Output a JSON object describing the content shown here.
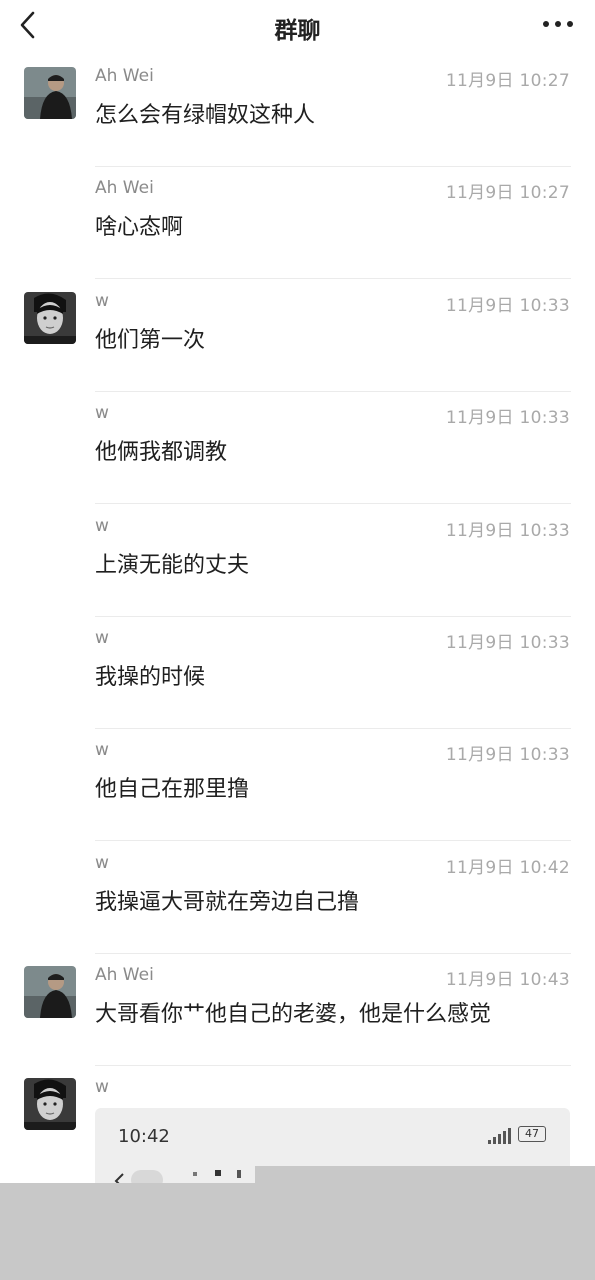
{
  "header": {
    "title": "群聊",
    "back_icon": "chevron-left-icon",
    "more_icon": "more-dots-icon"
  },
  "messages": [
    {
      "sender": "Ah Wei",
      "time": "11月9日 10:27",
      "text": "怎么会有绿帽奴这种人",
      "avatar": "man-dark-jacket-avatar"
    },
    {
      "sender": "Ah Wei",
      "time": "11月9日 10:27",
      "text": "啥心态啊"
    },
    {
      "sender": "w",
      "time": "11月9日 10:33",
      "text": "他们第一次",
      "avatar": "man-portrait-avatar"
    },
    {
      "sender": "w",
      "time": "11月9日 10:33",
      "text": "他俩我都调教"
    },
    {
      "sender": "w",
      "time": "11月9日 10:33",
      "text": "上演无能的丈夫"
    },
    {
      "sender": "w",
      "time": "11月9日 10:33",
      "text": "我操的时候"
    },
    {
      "sender": "w",
      "time": "11月9日 10:33",
      "text": "他自己在那里撸"
    },
    {
      "sender": "w",
      "time": "11月9日 10:42",
      "text": "我操逼大哥就在旁边自己撸"
    },
    {
      "sender": "Ah Wei",
      "time": "11月9日 10:43",
      "text": "大哥看你艹他自己的老婆，他是什么感觉",
      "avatar": "man-dark-jacket-avatar"
    },
    {
      "sender": "w",
      "avatar": "man-portrait-avatar"
    }
  ],
  "attachment": {
    "type": "screenshot-image",
    "time": "10:42",
    "battery": "47",
    "signal_icon": "signal-bars-icon",
    "battery_icon": "battery-icon",
    "back_icon": "chevron-left-icon"
  }
}
